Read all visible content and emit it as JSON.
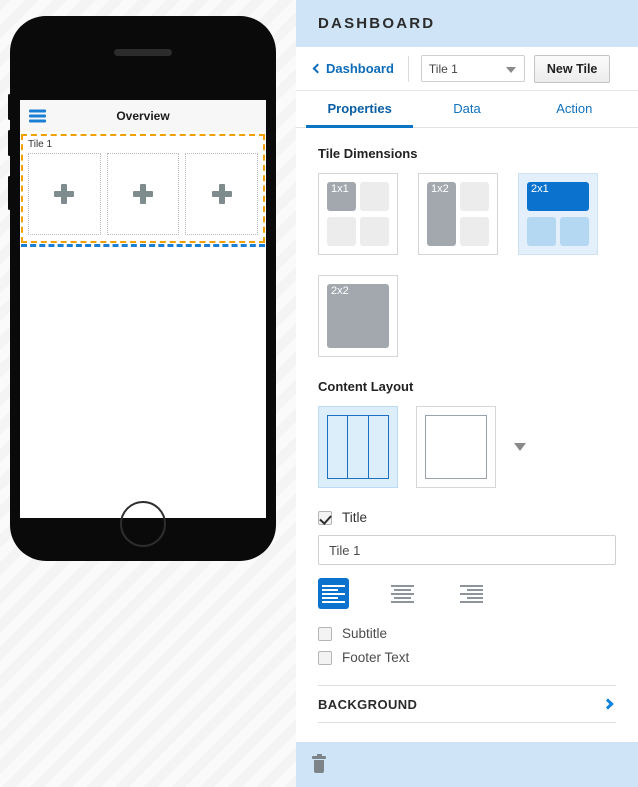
{
  "preview": {
    "app_bar": {
      "menu_icon": "hamburger-menu-icon",
      "title": "Overview"
    },
    "tile": {
      "label": "Tile 1",
      "cells": [
        {
          "icon": "plus-icon"
        },
        {
          "icon": "plus-icon"
        },
        {
          "icon": "plus-icon"
        }
      ],
      "selection_border_color": "#f0a000",
      "drop_indicator_color": "#1a7fd4"
    }
  },
  "inspector": {
    "header": {
      "title": "DASHBOARD",
      "background": "#cfe5f7"
    },
    "breadcrumb": {
      "back_icon": "chevron-left-icon",
      "back_label": "Dashboard",
      "tile_select_value": "Tile 1",
      "tile_select_caret": "triangle-down-icon",
      "new_tile_label": "New Tile"
    },
    "tabs": [
      {
        "label": "Properties",
        "active": true
      },
      {
        "label": "Data",
        "active": false
      },
      {
        "label": "Action",
        "active": false
      }
    ],
    "tile_dimensions": {
      "title": "Tile Dimensions",
      "options": [
        {
          "label": "1x1",
          "selected": false
        },
        {
          "label": "1x2",
          "selected": false
        },
        {
          "label": "2x1",
          "selected": true
        },
        {
          "label": "2x2",
          "selected": false
        }
      ],
      "selected_color": "#0b72cd",
      "unselected_color": "#a2a8ae"
    },
    "content_layout": {
      "title": "Content Layout",
      "options": [
        {
          "name": "three-column-layout",
          "selected": true
        },
        {
          "name": "single-cell-layout",
          "selected": false
        }
      ],
      "more_icon": "triangle-down-icon"
    },
    "title_field": {
      "checkbox_checked": true,
      "checkbox_label": "Title",
      "value": "Tile 1",
      "placeholder": "Tile 1"
    },
    "alignment": [
      {
        "name": "align-left",
        "active": true
      },
      {
        "name": "align-center",
        "active": false
      },
      {
        "name": "align-right",
        "active": false
      }
    ],
    "subtitle": {
      "checked": false,
      "label": "Subtitle"
    },
    "footer_text": {
      "checked": false,
      "label": "Footer Text"
    },
    "background_section": {
      "title": "BACKGROUND",
      "chevron": "chevron-right-icon"
    },
    "footer_bar": {
      "delete_icon": "trash-icon",
      "background": "#cfe5f7"
    }
  }
}
